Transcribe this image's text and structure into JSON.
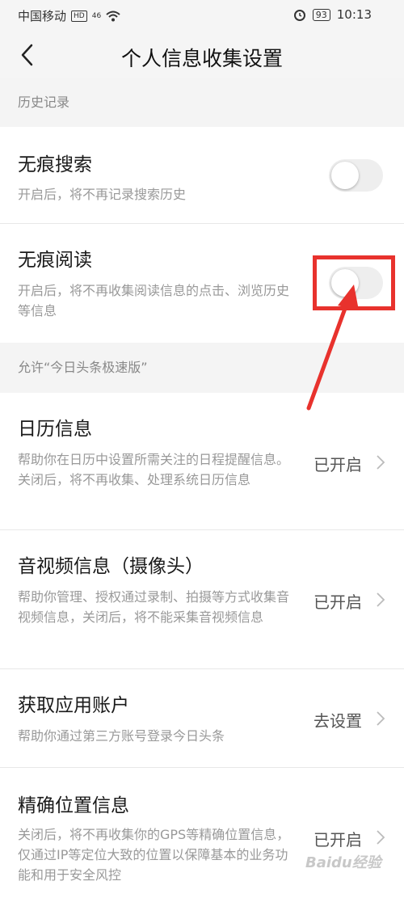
{
  "status_bar": {
    "carrier": "中国移动",
    "hd": "HD",
    "network": "46",
    "battery": "93",
    "time": "10:13"
  },
  "nav": {
    "title": "个人信息收集设置"
  },
  "sections": [
    {
      "title": "历史记录"
    },
    {
      "title": "允许“今日头条极速版”"
    }
  ],
  "toggles": [
    {
      "title": "无痕搜索",
      "desc": "开启后，将不再记录搜索历史",
      "on": false
    },
    {
      "title": "无痕阅读",
      "desc": "开启后，将不再收集阅读信息的点击、浏览历史等信息",
      "on": false
    }
  ],
  "permissions": [
    {
      "title": "日历信息",
      "desc": "帮助你在日历中设置所需关注的日程提醒信息。关闭后，将不再收集、处理系统日历信息",
      "status": "已开启"
    },
    {
      "title": "音视频信息（摄像头）",
      "desc": "帮助你管理、授权通过录制、拍摄等方式收集音视频信息，关闭后，将不能采集音视频信息",
      "status": "已开启"
    },
    {
      "title": "获取应用账户",
      "desc": "帮助你通过第三方账号登录今日头条",
      "status": "去设置"
    },
    {
      "title": "精确位置信息",
      "desc": "关闭后，将不再收集你的GPS等精确位置信息，仅通过IP等定位大致的位置以保障基本的业务功能和用于安全风控",
      "status": "已开启"
    }
  ],
  "watermark": "Baidu经验",
  "colors": {
    "highlight": "#e8322d",
    "section_bg": "#f4f4f4",
    "toggle_off": "#eeeeee"
  }
}
